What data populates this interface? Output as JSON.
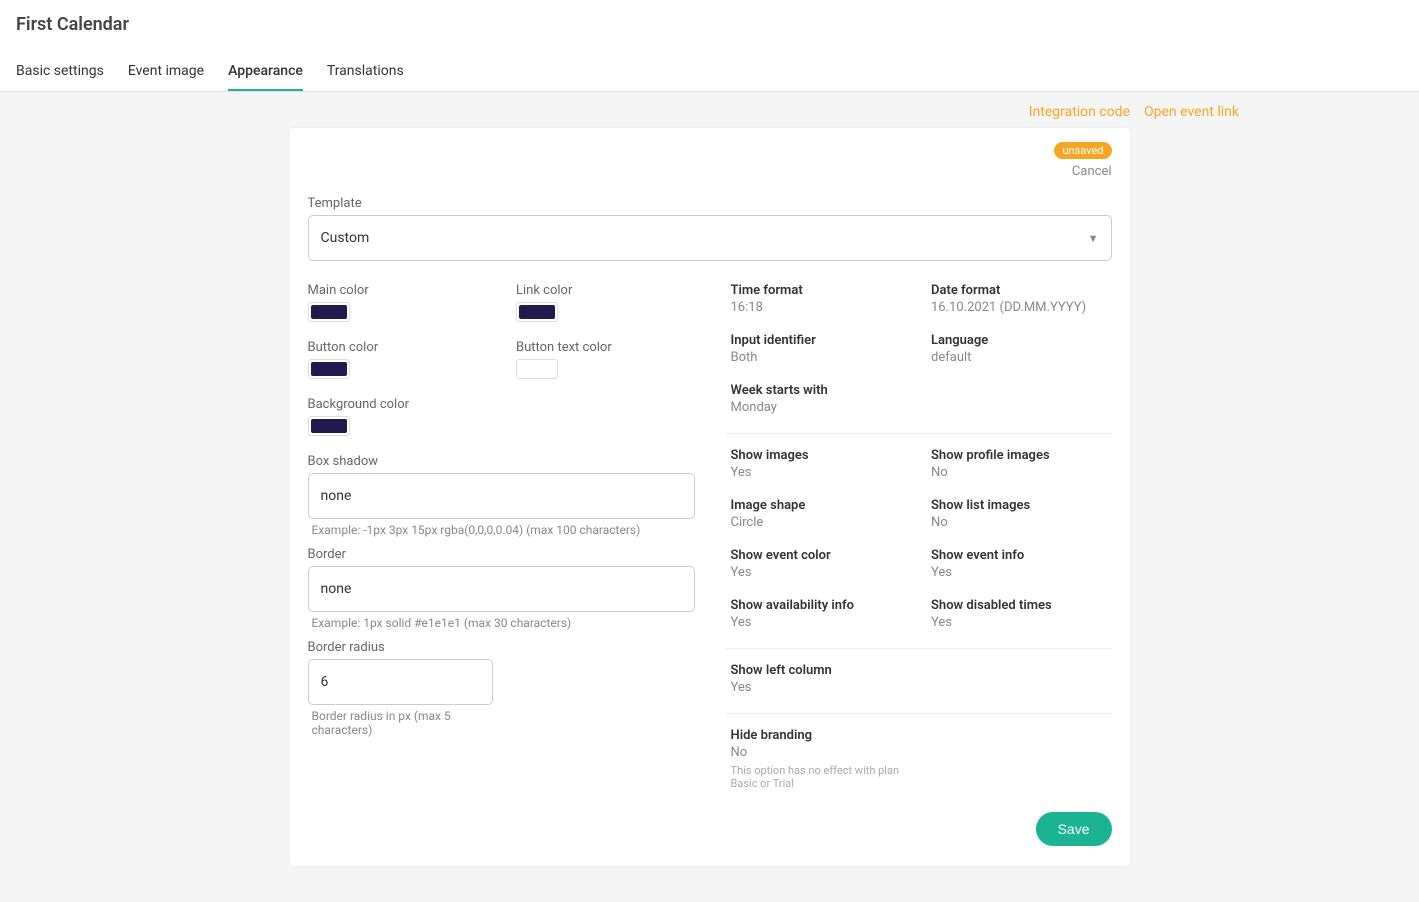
{
  "header": {
    "title": "First Calendar",
    "tabs": [
      {
        "label": "Basic settings",
        "active": false
      },
      {
        "label": "Event image",
        "active": false
      },
      {
        "label": "Appearance",
        "active": true
      },
      {
        "label": "Translations",
        "active": false
      }
    ]
  },
  "actions": {
    "integration_code": "Integration code",
    "open_event_link": "Open event link"
  },
  "top": {
    "unsaved_badge": "unsaved",
    "cancel": "Cancel"
  },
  "template": {
    "label": "Template",
    "value": "Custom"
  },
  "colors": {
    "main": {
      "label": "Main color",
      "value": "#201a4e"
    },
    "link": {
      "label": "Link color",
      "value": "#201a4e"
    },
    "button": {
      "label": "Button color",
      "value": "#201a4e"
    },
    "button_text": {
      "label": "Button text color",
      "value": "#ffffff"
    },
    "background": {
      "label": "Background color",
      "value": "#201a4e"
    }
  },
  "box_shadow": {
    "label": "Box shadow",
    "value": "none",
    "helper": "Example: -1px 3px 15px rgba(0,0,0,0.04) (max 100 characters)"
  },
  "border": {
    "label": "Border",
    "value": "none",
    "helper": "Example: 1px solid #e1e1e1 (max 30 characters)"
  },
  "border_radius": {
    "label": "Border radius",
    "value": "6",
    "helper": "Border radius in px (max 5 characters)"
  },
  "settings_group_1": [
    {
      "label": "Time format",
      "value": "16:18"
    },
    {
      "label": "Date format",
      "value": "16.10.2021 (DD.MM.YYYY)"
    },
    {
      "label": "Input identifier",
      "value": "Both"
    },
    {
      "label": "Language",
      "value": "default"
    },
    {
      "label": "Week starts with",
      "value": "Monday"
    }
  ],
  "settings_group_2": [
    {
      "label": "Show images",
      "value": "Yes"
    },
    {
      "label": "Show profile images",
      "value": "No"
    },
    {
      "label": "Image shape",
      "value": "Circle"
    },
    {
      "label": "Show list images",
      "value": "No"
    },
    {
      "label": "Show event color",
      "value": "Yes"
    },
    {
      "label": "Show event info",
      "value": "Yes"
    },
    {
      "label": "Show availability info",
      "value": "Yes"
    },
    {
      "label": "Show disabled times",
      "value": "Yes"
    }
  ],
  "settings_group_3": [
    {
      "label": "Show left column",
      "value": "Yes"
    }
  ],
  "settings_group_4": [
    {
      "label": "Hide branding",
      "value": "No",
      "note": "This option has no effect with plan Basic or Trial"
    }
  ],
  "save_label": "Save"
}
